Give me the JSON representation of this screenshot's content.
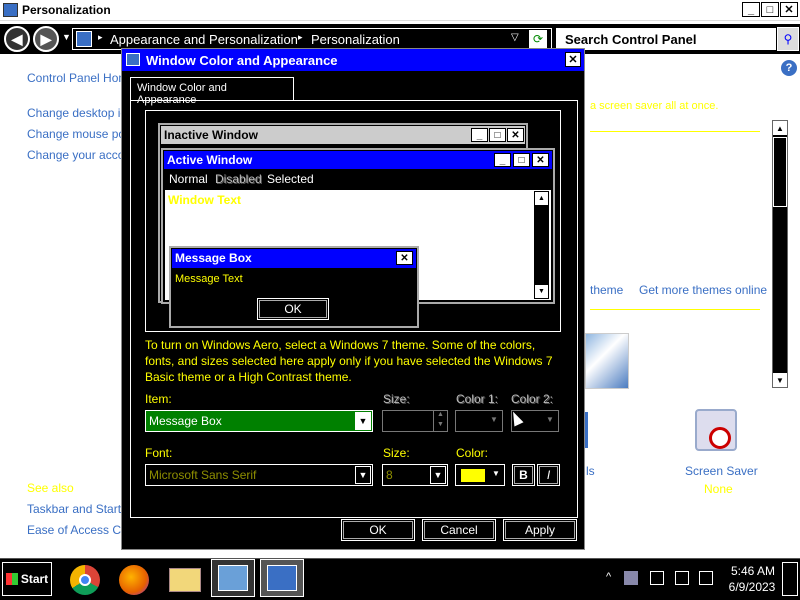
{
  "window": {
    "title": "Personalization",
    "controls": [
      "_",
      "□",
      "✕"
    ]
  },
  "address": {
    "crumbs": [
      "Appearance and Personalization",
      "Personalization"
    ],
    "search_placeholder": "Search Control Panel"
  },
  "left_nav": {
    "home": "Control Panel Home",
    "links": [
      "Change desktop ico",
      "Change mouse poin",
      "Change your accou"
    ],
    "see_also_heading": "See also",
    "see_also": [
      "Taskbar and Start M",
      "Ease of Access Cer"
    ]
  },
  "background": {
    "right_partial": "a screen saver all at once.",
    "theme_link_partial": "theme",
    "get_more_themes": "Get more themes online",
    "screen_saver_label": "Screen Saver",
    "screen_saver_value": "None",
    "sounds_partial": "ls"
  },
  "dialog": {
    "title": "Window Color and Appearance",
    "tab": "Window Color and Appearance",
    "preview": {
      "inactive_title": "Inactive Window",
      "active_title": "Active Window",
      "menu": [
        "Normal",
        "Disabled",
        "Selected"
      ],
      "window_text": "Window Text",
      "msgbox_title": "Message Box",
      "msgbox_text": "Message Text",
      "msgbox_ok": "OK"
    },
    "info": "To turn on Windows Aero, select a Windows 7 theme.  Some of the colors, fonts, and sizes selected here apply only if you have selected the Windows 7 Basic theme or a High Contrast theme.",
    "item_label": "Item:",
    "item_value": "Message Box",
    "size_label": "Size:",
    "color1_label": "Color 1:",
    "color2_label": "Color 2:",
    "font_label": "Font:",
    "font_value": "Microsoft Sans Serif",
    "font_size_label": "Size:",
    "font_size_value": "8",
    "font_color_label": "Color:",
    "font_color_value": "#ffff00",
    "bold_label": "B",
    "italic_label": "I",
    "ok": "OK",
    "cancel": "Cancel",
    "apply": "Apply"
  },
  "taskbar": {
    "start": "Start",
    "time": "5:46 AM",
    "date": "6/9/2023"
  },
  "colors": {
    "active_title": "#0000ff",
    "highlight_text": "#ffff00",
    "item_bg": "#008000"
  }
}
